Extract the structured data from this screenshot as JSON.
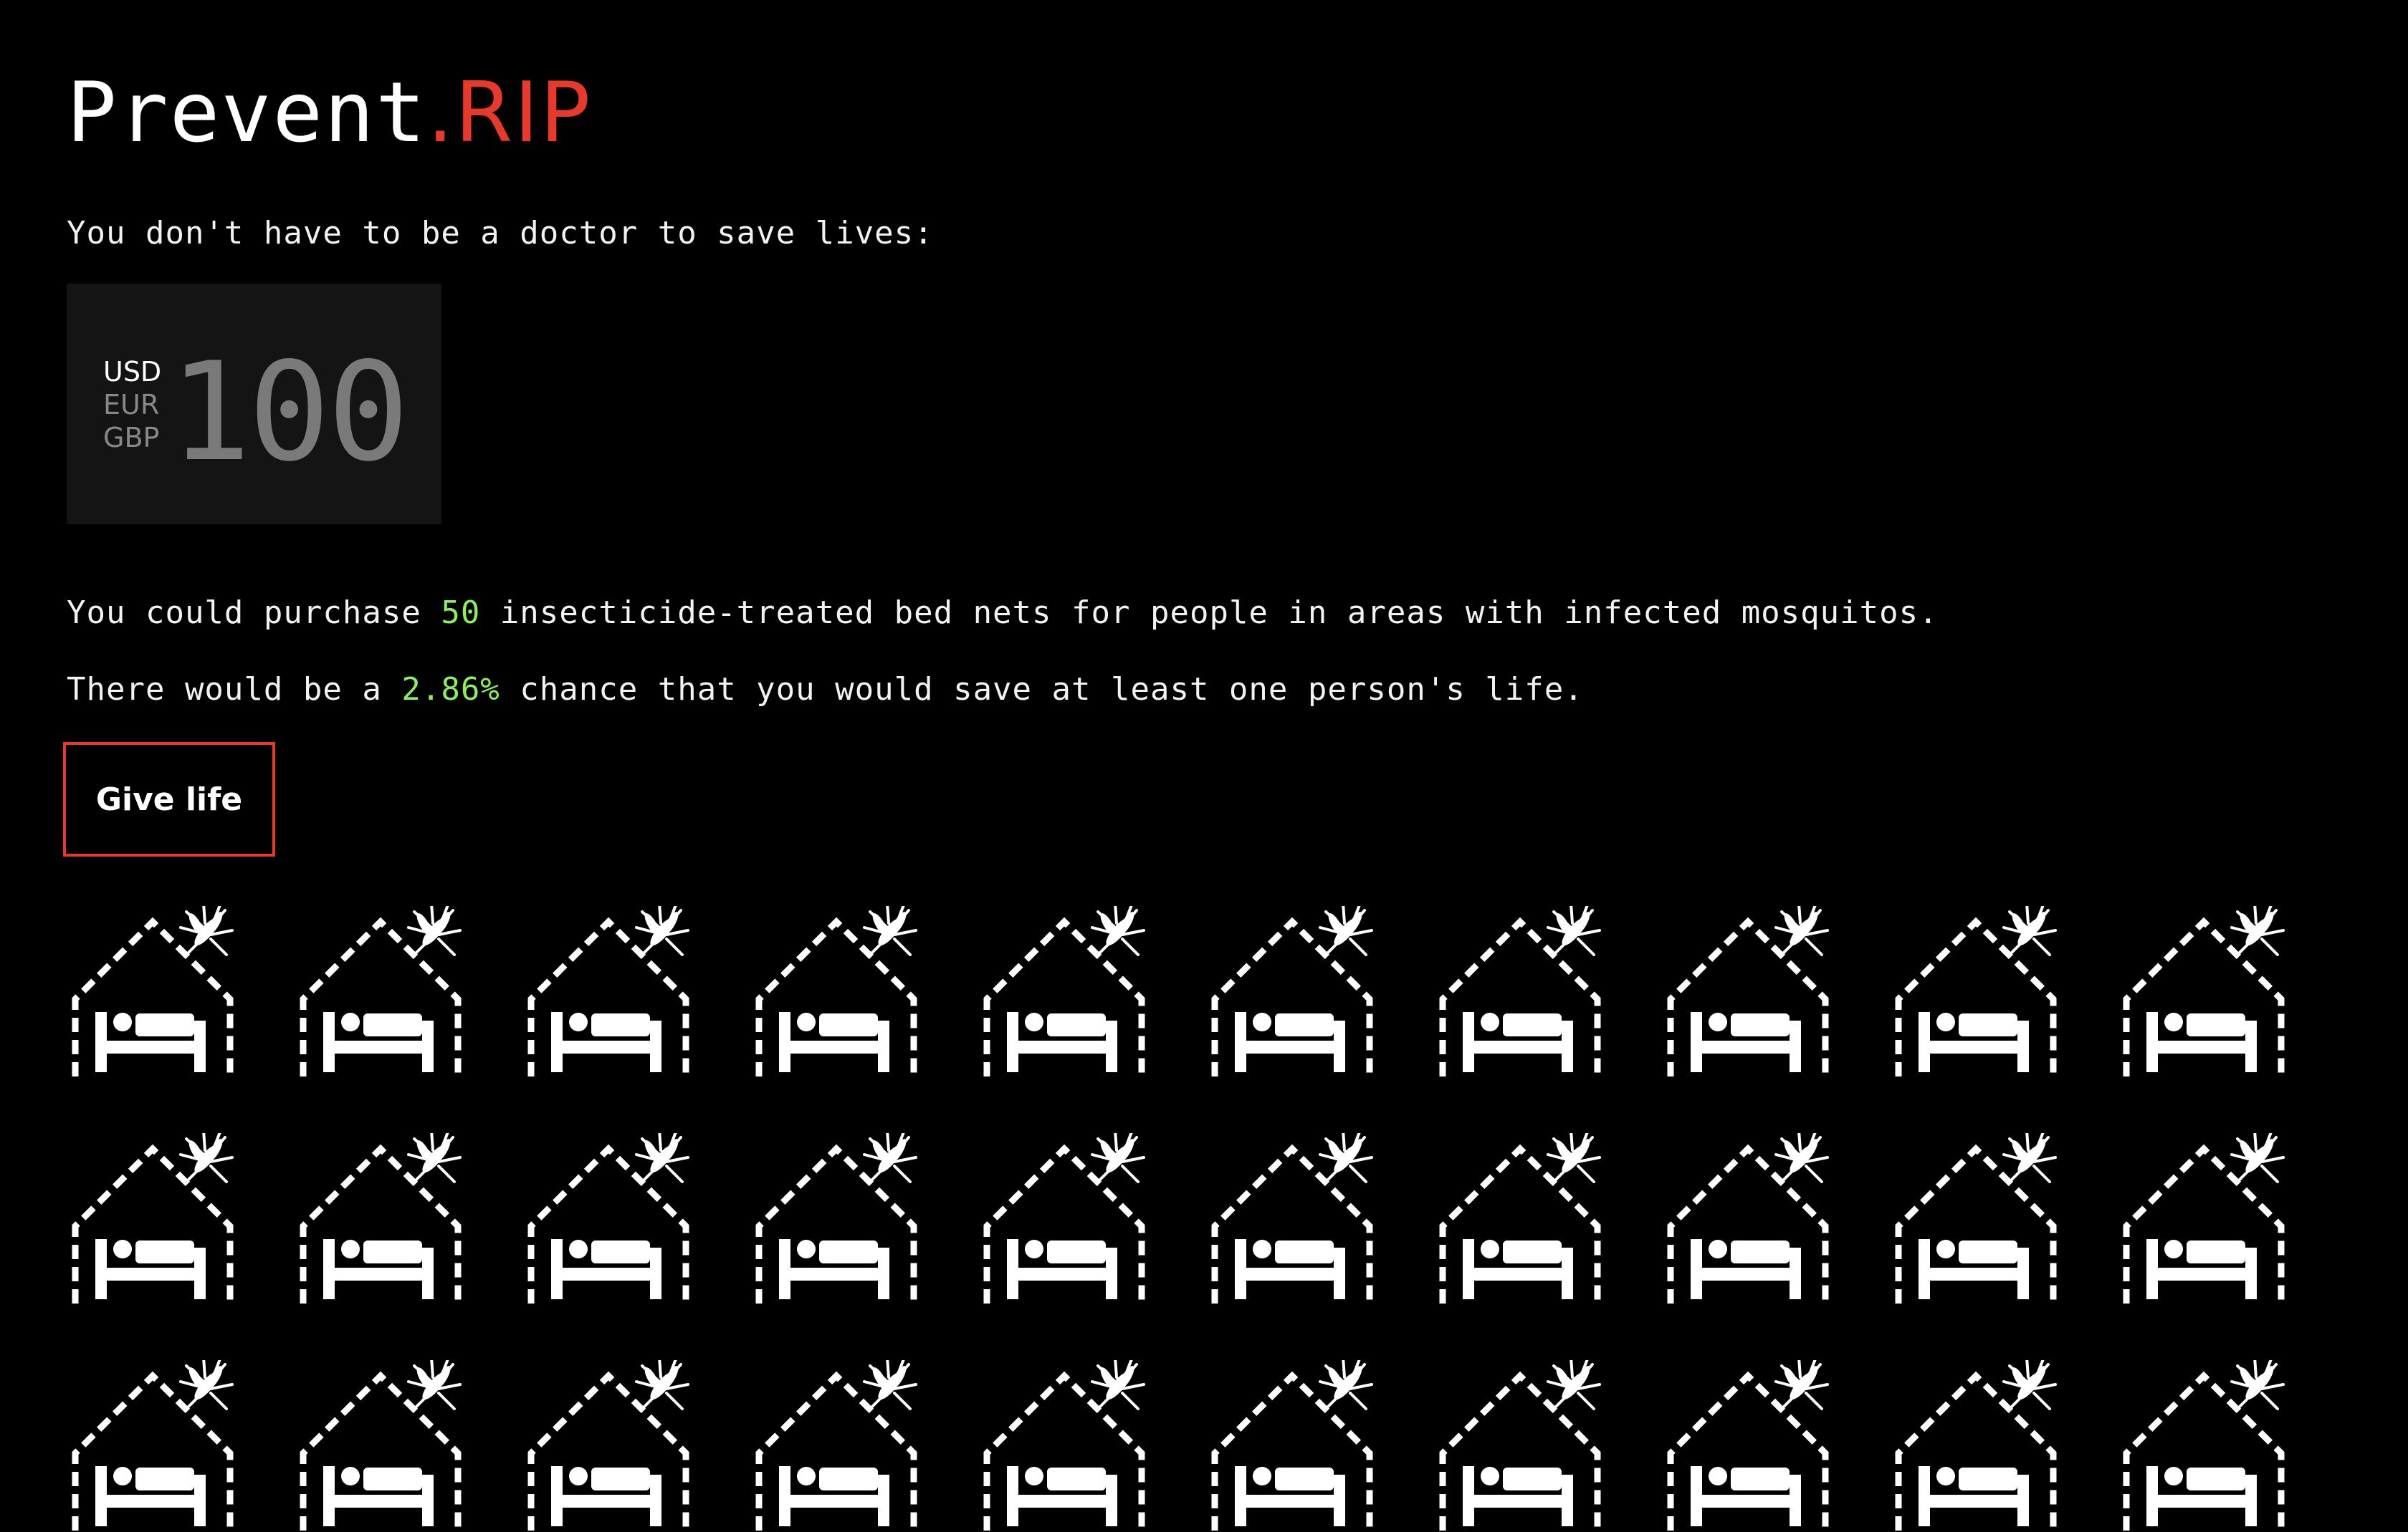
{
  "logo": {
    "brand": "Prevent",
    "accent": ".RIP"
  },
  "tagline": "You don't have to be a doctor to save lives:",
  "donation": {
    "currencies": [
      "USD",
      "EUR",
      "GBP"
    ],
    "selected_currency": "USD",
    "amount": "100"
  },
  "result": {
    "line1_prefix": "You could purchase ",
    "nets_count": "50",
    "line1_suffix": " insecticide-treated bed nets for people in areas with infected mosquitos.",
    "line2_prefix": "There would be a ",
    "chance": "2.86%",
    "line2_suffix": " chance that you would save at least one person's life."
  },
  "button": {
    "label": "Give life"
  },
  "bed_nets": {
    "icon": "bed-net-mosquito-icon",
    "visible_count": 30
  },
  "colors": {
    "background": "#000000",
    "accent": "#e8392b",
    "highlight": "#8cf05a",
    "amount_box": "#141414"
  }
}
